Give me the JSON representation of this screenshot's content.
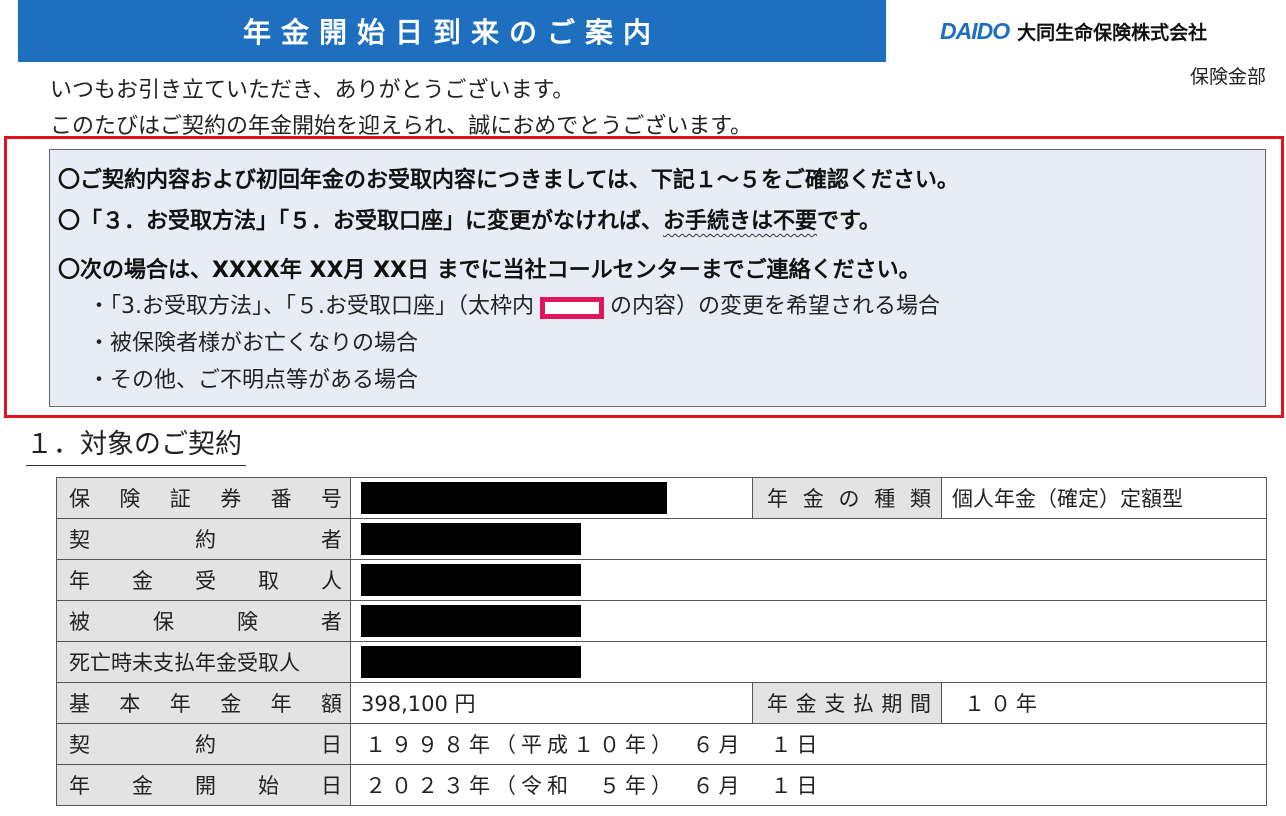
{
  "header": {
    "title": "年金開始日到来のご案内",
    "logo_mark": "DAIDO",
    "company": "大同生命保険株式会社",
    "department": "保険金部"
  },
  "greeting": {
    "line1": "いつもお引き立ていただき、ありがとうございます。",
    "line2": "このたびはご契約の年金開始を迎えられ、誠におめでとうございます。"
  },
  "notices": {
    "n1": "〇ご契約内容および初回年金のお受取内容につきましては、下記１～５をご確認ください。",
    "n2_prefix": "〇「３．お受取方法」「５．お受取口座」に変更がなければ、",
    "n2_emphasis": "お手続きは不要",
    "n2_suffix": "です。",
    "n3": "〇次の場合は、XXXX年 XX月 XX日 までに当社コールセンターまでご連絡ください。",
    "b1_prefix": "・「3.お受取方法」、「５.お受取口座」（太枠内",
    "b1_suffix": "の内容）の変更を希望される場合",
    "b2": "・被保険者様がお亡くなりの場合",
    "b3": "・その他、ご不明点等がある場合"
  },
  "section1": {
    "heading": "１．対象のご契約",
    "rows": {
      "policy_number_label": "保険証券番号",
      "annuity_type_label": "年金の種類",
      "annuity_type_value": "個人年金（確定）定額型",
      "policyholder_label": "契約者",
      "recipient_label": "年金受取人",
      "insured_label": "被保険者",
      "death_recipient_label": "死亡時未支払年金受取人",
      "base_amount_label": "基本年金年額",
      "base_amount_value": "398,100 円",
      "payment_period_label": "年金支払期間",
      "payment_period_value": "１０年",
      "contract_date_label": "契約日",
      "contract_date_value": "１９９８年（平成１０年）　６月　１日",
      "start_date_label": "年金開始日",
      "start_date_value": "２０２３年（令和　５年）　６月　１日"
    }
  },
  "colors": {
    "banner": "#1e6fc0",
    "highlight_frame": "#e0141e",
    "marker": "#e0145a",
    "info_bg": "#e8edf5",
    "label_bg": "#e3e3e3"
  }
}
